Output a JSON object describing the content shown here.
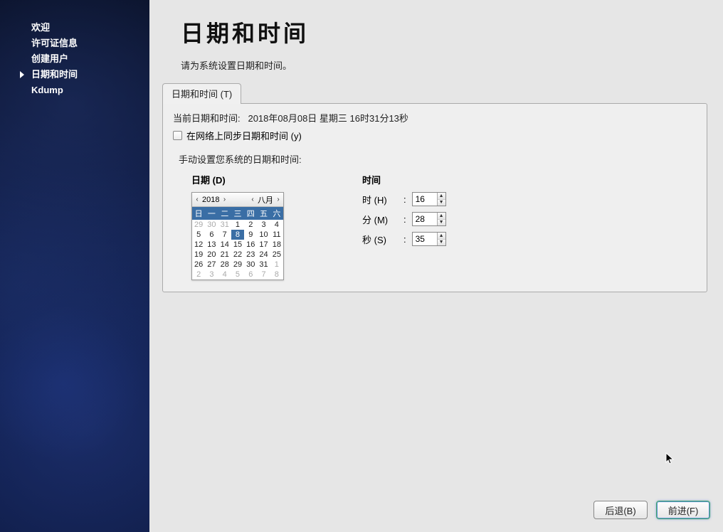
{
  "sidebar": {
    "items": [
      {
        "label": "欢迎"
      },
      {
        "label": "许可证信息"
      },
      {
        "label": "创建用户"
      },
      {
        "label": "日期和时间"
      },
      {
        "label": "Kdump"
      }
    ],
    "current_index": 3
  },
  "page": {
    "title": "日期和时间",
    "subtitle": "请为系统设置日期和时间。"
  },
  "tab": {
    "label": "日期和时间 (T)"
  },
  "panel": {
    "current_label": "当前日期和时间:",
    "current_value": "2018年08月08日 星期三 16时31分13秒",
    "sync_label": "在网络上同步日期和时间 (y)",
    "sync_checked": false,
    "manual_label": "手动设置您系统的日期和时间:"
  },
  "date_section": {
    "label": "日期 (D)",
    "year": "2018",
    "month": "八月",
    "weekdays": [
      "日",
      "一",
      "二",
      "三",
      "四",
      "五",
      "六"
    ],
    "rows": [
      [
        {
          "d": "29",
          "o": true
        },
        {
          "d": "30",
          "o": true
        },
        {
          "d": "31",
          "o": true
        },
        {
          "d": "1"
        },
        {
          "d": "2"
        },
        {
          "d": "3"
        },
        {
          "d": "4"
        }
      ],
      [
        {
          "d": "5"
        },
        {
          "d": "6"
        },
        {
          "d": "7"
        },
        {
          "d": "8",
          "sel": true
        },
        {
          "d": "9"
        },
        {
          "d": "10"
        },
        {
          "d": "11"
        }
      ],
      [
        {
          "d": "12"
        },
        {
          "d": "13"
        },
        {
          "d": "14"
        },
        {
          "d": "15"
        },
        {
          "d": "16"
        },
        {
          "d": "17"
        },
        {
          "d": "18"
        }
      ],
      [
        {
          "d": "19"
        },
        {
          "d": "20"
        },
        {
          "d": "21"
        },
        {
          "d": "22"
        },
        {
          "d": "23"
        },
        {
          "d": "24"
        },
        {
          "d": "25"
        }
      ],
      [
        {
          "d": "26"
        },
        {
          "d": "27"
        },
        {
          "d": "28"
        },
        {
          "d": "29"
        },
        {
          "d": "30"
        },
        {
          "d": "31"
        },
        {
          "d": "1",
          "o": true
        }
      ],
      [
        {
          "d": "2",
          "o": true
        },
        {
          "d": "3",
          "o": true
        },
        {
          "d": "4",
          "o": true
        },
        {
          "d": "5",
          "o": true
        },
        {
          "d": "6",
          "o": true
        },
        {
          "d": "7",
          "o": true
        },
        {
          "d": "8",
          "o": true
        }
      ]
    ]
  },
  "time_section": {
    "label": "时间",
    "hour_label": "时 (H)",
    "minute_label": "分 (M)",
    "second_label": "秒 (S)",
    "hour": "16",
    "minute": "28",
    "second": "35",
    "colon": ":"
  },
  "footer": {
    "back": "后退(B)",
    "forward": "前进(F)"
  }
}
